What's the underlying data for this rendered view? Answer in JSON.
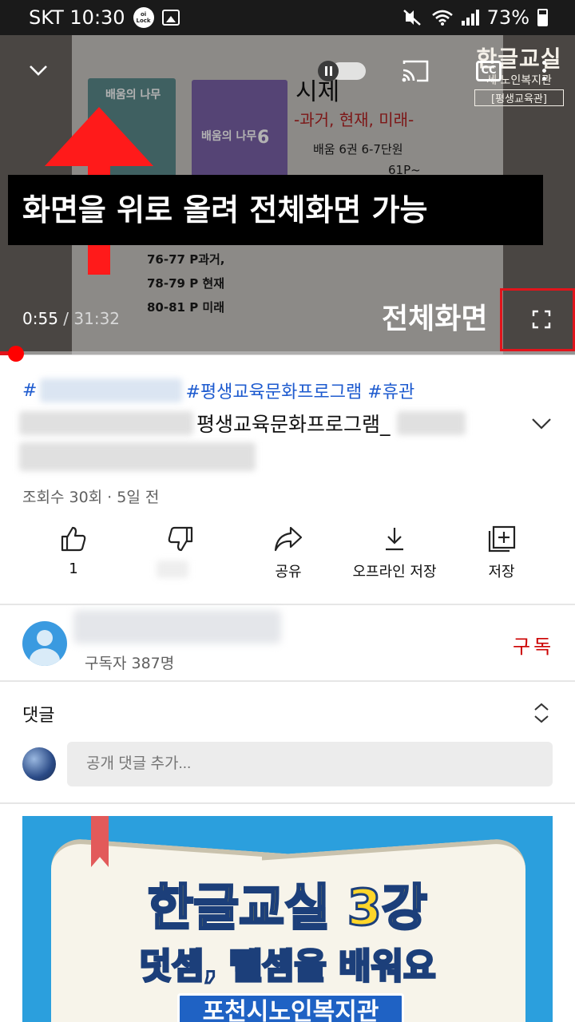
{
  "status_bar": {
    "carrier_time": "SKT 10:30",
    "olock_text": "oi\nLock",
    "battery": "73%",
    "icons": [
      "olock-icon",
      "gallery-icon",
      "mute-icon",
      "wifi-icon",
      "signal-icon",
      "battery-icon"
    ]
  },
  "player": {
    "corner_logo": {
      "line1": "한글교실",
      "line2": "세 노인복지관",
      "line3": "[평생교육관]"
    },
    "slide": {
      "title": "시제",
      "subtitle": "-과거, 현재, 미래-",
      "book1_title": "배움의 나무",
      "book2_title": "배움의 나무",
      "book2_number": "6",
      "line1": "배움 6권 6-7단원",
      "line2": "61P~",
      "line3": "76-77 P과거,",
      "line4": "78-79 P 현재",
      "line5": "80-81 P 미래"
    },
    "annotation": "화면을 위로 올려 전체화면 가능",
    "time_current": "0:55",
    "time_separator": " / ",
    "time_duration": "31:32",
    "fullscreen_label": "전체화면",
    "cc_label": "CC",
    "progress_fraction": 0.029,
    "accent_color": "#e1141b"
  },
  "video": {
    "hashtag_prefix": "#",
    "hashtags_visible": "#평생교육문화프로그램 #휴관",
    "title_visible": "평생교육문화프로그램_",
    "meta": "조회수 30회 · 5일 전"
  },
  "actions": {
    "like_count": "1",
    "share_label": "공유",
    "offline_label": "오프라인 저장",
    "save_label": "저장"
  },
  "channel": {
    "subscribers": "구독자 387명",
    "subscribe_label": "구독",
    "subscribe_color": "#cc0000"
  },
  "comments": {
    "header": "댓글",
    "placeholder": "공개 댓글 추가..."
  },
  "banner": {
    "title": "한글교실 3강",
    "subtitle": "덧셈, 뺄셈을 배워요",
    "org": "포천시노인복지관",
    "background": "#2b9fdd"
  }
}
